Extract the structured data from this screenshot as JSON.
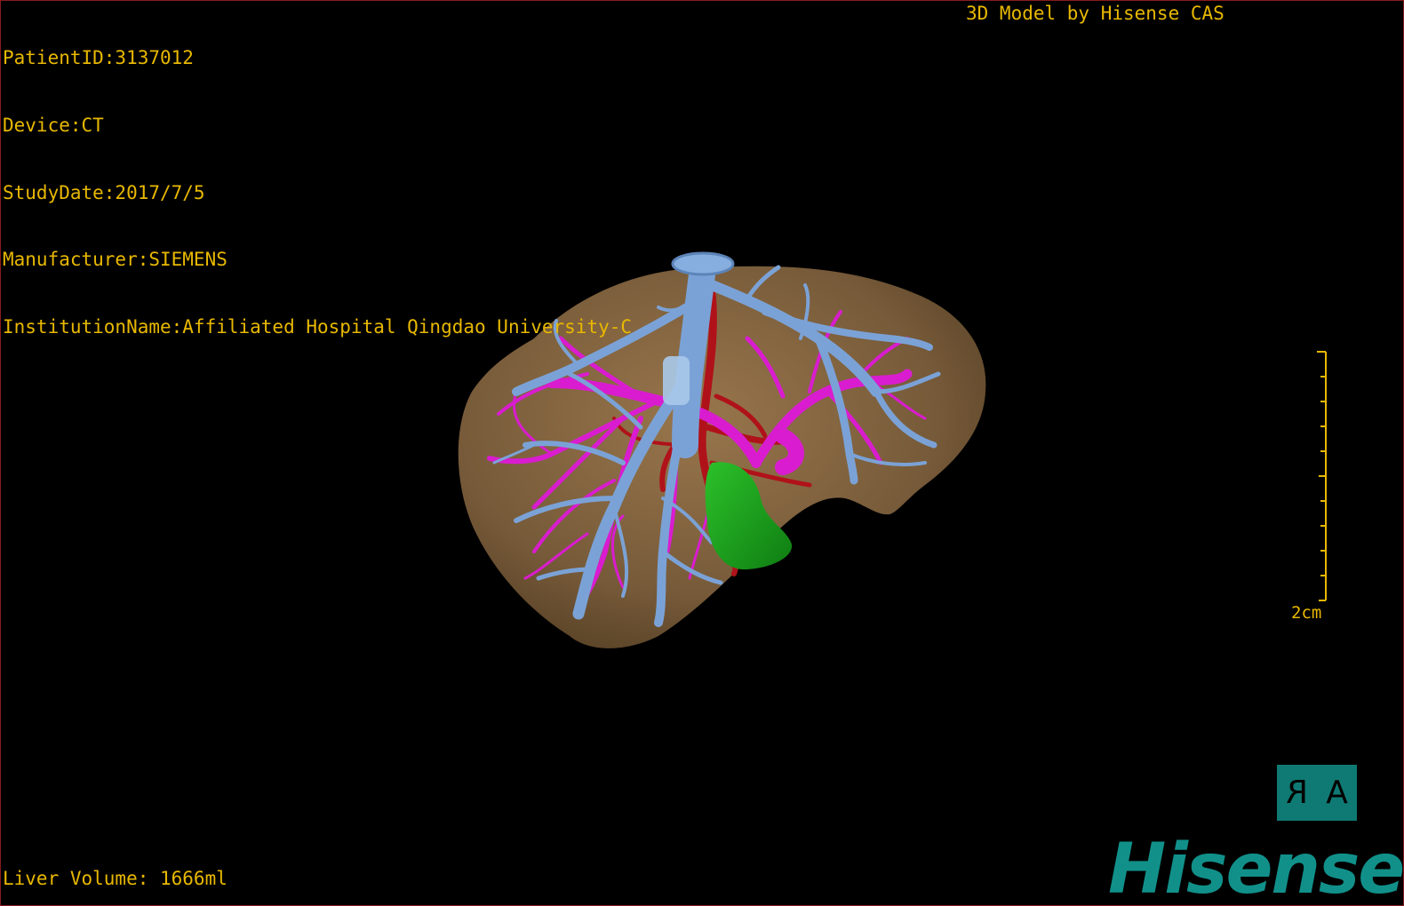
{
  "overlay": {
    "patient_id": "PatientID:3137012",
    "device": "Device:CT",
    "study_date": "StudyDate:2017/7/5",
    "manufacturer": "Manufacturer:SIEMENS",
    "institution": "InstitutionName:Affiliated Hospital Qingdao University-C",
    "model_credit": "3D Model by Hisense CAS",
    "liver_volume": "Liver Volume: 1666ml",
    "scale_label": "2cm"
  },
  "orientation": {
    "left_glyph": "R",
    "right_glyph": "A"
  },
  "brand": {
    "logo_text": "Hisense"
  },
  "colors": {
    "overlay_text": "#e8b800",
    "liver": "#8a6a43",
    "hepatic_vein": "#7ba2d6",
    "portal_vein": "#d91ccf",
    "artery": "#b0121a",
    "gallbladder": "#1fa51e",
    "brand": "#11908a"
  }
}
